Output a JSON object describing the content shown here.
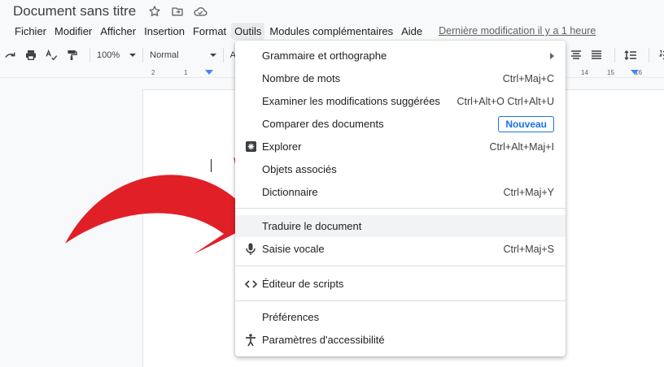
{
  "window": {
    "title": "Document sans titre"
  },
  "menubar": {
    "items": [
      "Fichier",
      "Modifier",
      "Afficher",
      "Insertion",
      "Format",
      "Outils",
      "Modules complémentaires",
      "Aide"
    ],
    "active": "Outils",
    "last_edit": "Dernière modification il y a 1 heure"
  },
  "toolbar": {
    "zoom": "100%",
    "style": "Normal",
    "font": "Ar"
  },
  "ruler": {
    "left_numbers": [
      "2",
      "1"
    ],
    "right_numbers": [
      "14",
      "15",
      "16"
    ]
  },
  "tools_menu": {
    "items": [
      {
        "label": "Grammaire et orthographe",
        "shortcut": "",
        "has_submenu": true
      },
      {
        "label": "Nombre de mots",
        "shortcut": "Ctrl+Maj+C"
      },
      {
        "label": "Examiner les modifications suggérées",
        "shortcut": "Ctrl+Alt+O Ctrl+Alt+U"
      },
      {
        "label": "Comparer des documents",
        "shortcut": "",
        "badge": "Nouveau"
      },
      {
        "label": "Explorer",
        "shortcut": "Ctrl+Alt+Maj+I",
        "icon": "explore-icon"
      },
      {
        "label": "Objets associés",
        "shortcut": ""
      },
      {
        "label": "Dictionnaire",
        "shortcut": "Ctrl+Maj+Y"
      },
      {
        "label": "Traduire le document",
        "shortcut": "",
        "highlighted": true
      },
      {
        "label": "Saisie vocale",
        "shortcut": "Ctrl+Maj+S",
        "icon": "microphone-icon"
      },
      {
        "label": "Éditeur de scripts",
        "shortcut": "",
        "icon": "code-icon"
      },
      {
        "label": "Préférences",
        "shortcut": ""
      },
      {
        "label": "Paramètres d'accessibilité",
        "shortcut": "",
        "icon": "accessibility-icon"
      }
    ]
  },
  "colors": {
    "arrow": "#e11f26",
    "accent": "#1a73e8",
    "ruler_marker": "#4285f4"
  }
}
